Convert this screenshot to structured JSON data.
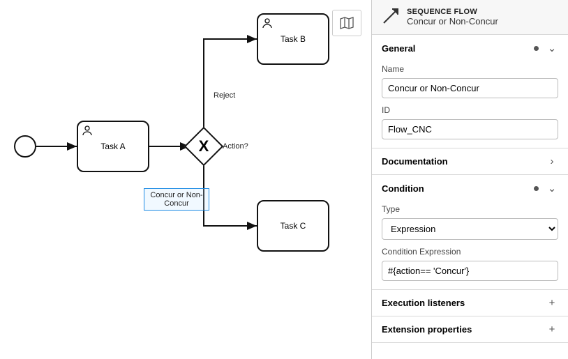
{
  "diagram": {
    "start": "",
    "tasks": {
      "A": "Task A",
      "B": "Task B",
      "C": "Task C"
    },
    "gateway_label": "Action?",
    "edges": {
      "reject": "Reject",
      "concur": "Concur or Non-Concur"
    }
  },
  "panel": {
    "header": {
      "type": "SEQUENCE FLOW",
      "name": "Concur or Non-Concur"
    },
    "general": {
      "title": "General",
      "name_label": "Name",
      "name_value": "Concur or Non-Concur",
      "id_label": "ID",
      "id_value": "Flow_CNC"
    },
    "documentation": {
      "title": "Documentation"
    },
    "condition": {
      "title": "Condition",
      "type_label": "Type",
      "type_value": "Expression",
      "expr_label": "Condition Expression",
      "expr_value": "#{action== 'Concur'}"
    },
    "execution_listeners": {
      "title": "Execution listeners"
    },
    "extension_properties": {
      "title": "Extension properties"
    }
  }
}
